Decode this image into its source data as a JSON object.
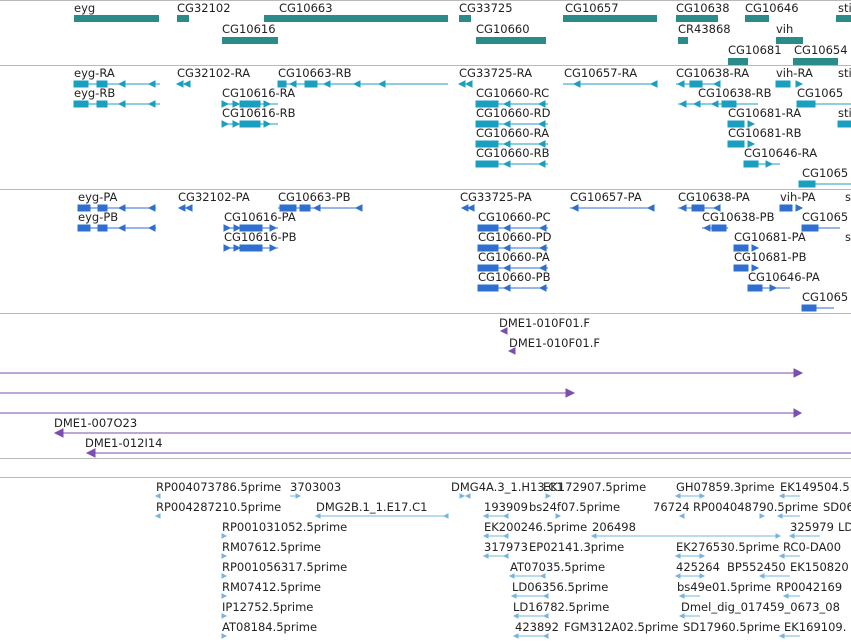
{
  "colors": {
    "gene": "#2b8b88",
    "transcript": "#1a9fc0",
    "protein": "#2f6fd0",
    "clone": "#7b4fb0",
    "est": "#76b4e2",
    "separator": "#b9b9b9"
  },
  "tracks": {
    "genes": {
      "labels": [
        "eyg",
        "CG32102",
        "CG10663",
        "CG10616",
        "CG33725",
        "CG10660",
        "CG10657",
        "CG10638",
        "CR43868",
        "CG10646",
        "vih",
        "CG10681",
        "CG10654",
        "sti"
      ]
    },
    "transcripts": {
      "labels": [
        "eyg-RA",
        "eyg-RB",
        "CG32102-RA",
        "CG10663-RB",
        "CG10616-RA",
        "CG10616-RB",
        "CG33725-RA",
        "CG10660-RC",
        "CG10660-RD",
        "CG10660-RA",
        "CG10660-RB",
        "CG10657-RA",
        "CG10638-RA",
        "CG10638-RB",
        "vih-RA",
        "CG1065",
        "CG10681-RA",
        "CG10681-RB",
        "CG10646-RA",
        "sti",
        "sti",
        "CG1065"
      ]
    },
    "proteins": {
      "labels": [
        "eyg-PA",
        "eyg-PB",
        "CG32102-PA",
        "CG10663-PB",
        "CG10616-PA",
        "CG10616-PB",
        "CG33725-PA",
        "CG10660-PC",
        "CG10660-PD",
        "CG10660-PA",
        "CG10660-PB",
        "CG10657-PA",
        "CG10638-PA",
        "CG10638-PB",
        "vih-PA",
        "CG1065",
        "CG10681-PA",
        "CG10681-PB",
        "CG10646-PA",
        "CG1065",
        "s",
        "s"
      ]
    },
    "clones": {
      "labels": [
        "DME1-010F01.F",
        "DME1-010F01.F",
        "DME1-007O23",
        "DME1-012I14"
      ]
    },
    "ests": {
      "labels": [
        "RP004073786.5prime",
        "3703003",
        "DMG4A.3_1.H13.C1",
        "EK172907.5prime",
        "GH07859.3prime",
        "EK149504.5",
        "RP004287210.5prime",
        "DMG2B.1_1.E17.C1",
        "193909",
        "bs24f07.5prime",
        "76724",
        "RP004048790.5prime",
        "SD06",
        "RP001031052.5prime",
        "EK200246.5prime",
        "206498",
        "325979",
        "LD",
        "RM07612.5prime",
        "317973",
        "EP02141.3prime",
        "EK276530.5prime",
        "RC0-DA00",
        "RP001056317.5prime",
        "AT07035.5prime",
        "425264",
        "BP552450",
        "EK150820",
        "RM07412.5prime",
        "LD06356.5prime",
        "bs49e01.5prime",
        "RP0042169",
        "IP12752.5prime",
        "LD16782.5prime",
        "Dmel_dig_017459_0673_08",
        "AT08184.5prime",
        "423892",
        "FGM312A02.5prime",
        "SD17960.5prime",
        "EK169109."
      ]
    }
  }
}
